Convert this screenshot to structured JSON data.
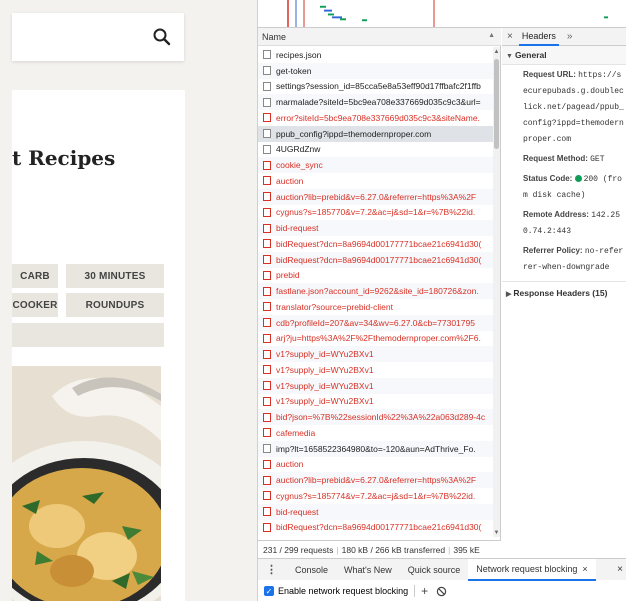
{
  "webpage": {
    "page_title": "t Recipes",
    "tags": [
      "CARB",
      "30 MINUTES",
      "COOKER",
      "ROUNDUPS",
      ""
    ]
  },
  "devtools": {
    "name_column": "Name",
    "requests": [
      {
        "name": "recipes.json",
        "error": false
      },
      {
        "name": "get-token",
        "error": false
      },
      {
        "name": "settings?session_id=85cca5e8a53eff90d17ffbafc2f1ffb",
        "error": false
      },
      {
        "name": "marmalade?siteId=5bc9ea708e337669d035c9c3&url=",
        "error": false
      },
      {
        "name": "error?siteId=5bc9ea708e337669d035c9c3&siteName.",
        "error": true
      },
      {
        "name": "ppub_config?ippd=themodernproper.com",
        "error": false,
        "selected": true
      },
      {
        "name": "4UGRdZnw",
        "error": false
      },
      {
        "name": "cookie_sync",
        "error": true
      },
      {
        "name": "auction",
        "error": true
      },
      {
        "name": "auction?lib=prebid&v=6.27.0&referrer=https%3A%2F",
        "error": true
      },
      {
        "name": "cygnus?s=185770&v=7.2&ac=j&sd=1&r=%7B%22id.",
        "error": true
      },
      {
        "name": "bid-request",
        "error": true
      },
      {
        "name": "bidRequest?dcn=8a9694d00177771bcae21c6941d30(",
        "error": true
      },
      {
        "name": "bidRequest?dcn=8a9694d00177771bcae21c6941d30(",
        "error": true
      },
      {
        "name": "prebid",
        "error": true
      },
      {
        "name": "fastlane.json?account_id=9262&site_id=180726&zon.",
        "error": true
      },
      {
        "name": "translator?source=prebid-client",
        "error": true
      },
      {
        "name": "cdb?profileId=207&av=34&wv=6.27.0&cb=77301795",
        "error": true
      },
      {
        "name": "arj?ju=https%3A%2F%2Fthemodernproper.com%2F6.",
        "error": true
      },
      {
        "name": "v1?supply_id=WYu2BXv1",
        "error": true
      },
      {
        "name": "v1?supply_id=WYu2BXv1",
        "error": true
      },
      {
        "name": "v1?supply_id=WYu2BXv1",
        "error": true
      },
      {
        "name": "v1?supply_id=WYu2BXv1",
        "error": true
      },
      {
        "name": "bid?json=%7B%22sessionId%22%3A%22a063d289-4c",
        "error": true
      },
      {
        "name": "cafemedia",
        "error": true
      },
      {
        "name": "imp?lt=1658522364980&to=-120&aun=AdThrive_Fo.",
        "error": false
      },
      {
        "name": "auction",
        "error": true
      },
      {
        "name": "auction?lib=prebid&v=6.27.0&referrer=https%3A%2F",
        "error": true
      },
      {
        "name": "cygnus?s=185774&v=7.2&ac=j&sd=1&r=%7B%22id.",
        "error": true
      },
      {
        "name": "bid-request",
        "error": true
      },
      {
        "name": "bidRequest?dcn=8a9694d00177771bcae21c6941d30(",
        "error": true
      }
    ],
    "status": {
      "requests": "231 / 299 requests",
      "transferred": "180 kB / 266 kB transferred",
      "resources": "395 kE"
    },
    "headers_panel": {
      "close": "×",
      "tab": "Headers",
      "more": "»",
      "general_title": "General",
      "fields": [
        {
          "key": "Request URL:",
          "value": "https://securepubads.g.doubleclick.net/pagead/ppub_config?ippd=themodernproper.com"
        },
        {
          "key": "Request Method:",
          "value": "GET"
        },
        {
          "key": "Status Code:",
          "value": "200  (from disk cache)",
          "status_dot": true
        },
        {
          "key": "Remote Address:",
          "value": "142.250.74.2:443"
        },
        {
          "key": "Referrer Policy:",
          "value": "no-referrer-when-downgrade"
        }
      ],
      "response_headers": "Response Headers (15)"
    },
    "drawer": {
      "tabs": [
        "Console",
        "What's New",
        "Quick source",
        "Network request blocking"
      ],
      "active_tab": "Network request blocking",
      "tab_close": "×",
      "drawer_close": "×",
      "enable_label": "Enable network request blocking",
      "add": "+"
    }
  }
}
